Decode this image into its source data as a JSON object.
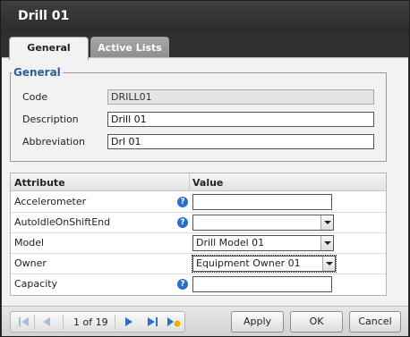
{
  "window": {
    "title": "Drill 01"
  },
  "tabs": [
    {
      "label": "General",
      "active": true
    },
    {
      "label": "Active Lists",
      "active": false
    }
  ],
  "general": {
    "legend": "General",
    "code": {
      "label": "Code",
      "value": "DRILL01",
      "readonly": true
    },
    "description": {
      "label": "Description",
      "value": "Drill 01"
    },
    "abbreviation": {
      "label": "Abbreviation",
      "value": "Drl 01"
    }
  },
  "grid": {
    "headers": {
      "attribute": "Attribute",
      "value": "Value"
    },
    "rows": [
      {
        "attribute": "Accelerometer",
        "value": "",
        "type": "text",
        "help": true
      },
      {
        "attribute": "AutoIdleOnShiftEnd",
        "value": "",
        "type": "combo",
        "help": true
      },
      {
        "attribute": "Model",
        "value": "Drill Model 01",
        "type": "combo",
        "help": false
      },
      {
        "attribute": "Owner",
        "value": "Equipment Owner 01",
        "type": "combo",
        "help": false,
        "focused": true
      },
      {
        "attribute": "Capacity",
        "value": "",
        "type": "text",
        "help": true
      }
    ],
    "help_glyph": "?"
  },
  "pager": {
    "text": "1 of 19"
  },
  "buttons": {
    "apply": "Apply",
    "ok": "OK",
    "cancel": "Cancel"
  },
  "colors": {
    "title_bar": "#2f2f2f",
    "legend": "#2e5e99",
    "help_icon": "#2a6fc9",
    "pager_arrow": "#2a6fc9",
    "add_star": "#e8b400"
  },
  "icons": [
    "first-page-icon",
    "previous-page-icon",
    "next-page-icon",
    "last-page-icon",
    "add-record-icon",
    "help-icon"
  ]
}
